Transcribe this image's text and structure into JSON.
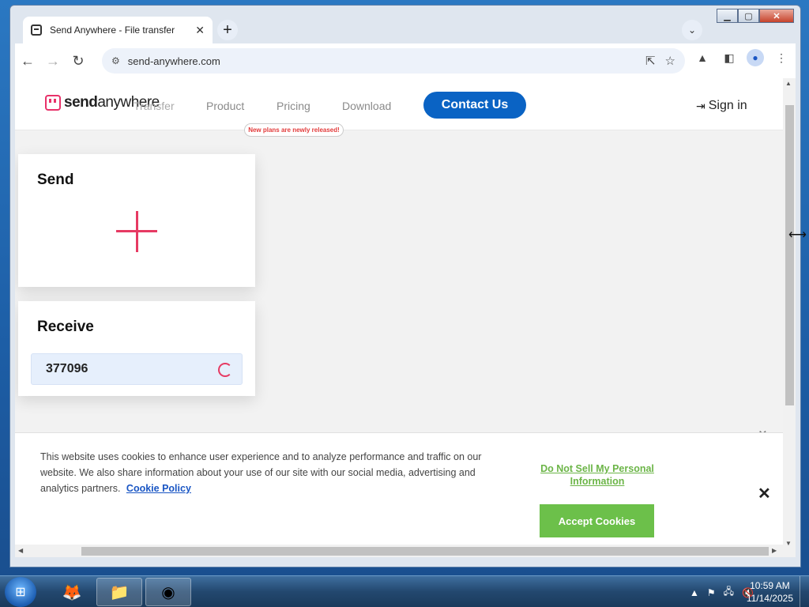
{
  "browser": {
    "tab_title": "Send Anywhere - File transfer",
    "url": "send-anywhere.com"
  },
  "site": {
    "logo_send": "send",
    "logo_anywhere": "anywhere",
    "nav_ghost": "Transfer",
    "nav": [
      "Product",
      "Pricing",
      "Download"
    ],
    "contact_button": "Contact Us",
    "sign_in": "Sign in",
    "new_plans_badge": "New plans are newly released!"
  },
  "send_card": {
    "title": "Send"
  },
  "receive_card": {
    "title": "Receive",
    "code": "377096"
  },
  "cookie_banner": {
    "text": "This website uses cookies to enhance user experience and to analyze performance and traffic on our website. We also share information about your use of our site with our social media, advertising and analytics partners.",
    "policy_link": "Cookie Policy",
    "do_not_sell": "Do Not Sell My Personal Information",
    "accept_button": "Accept Cookies"
  },
  "taskbar": {
    "time": "10:59 AM",
    "date": "11/14/2025"
  },
  "colors": {
    "brand_pink": "#e8326a",
    "contact_blue": "#0a63c4",
    "accept_green": "#6cc04a"
  }
}
